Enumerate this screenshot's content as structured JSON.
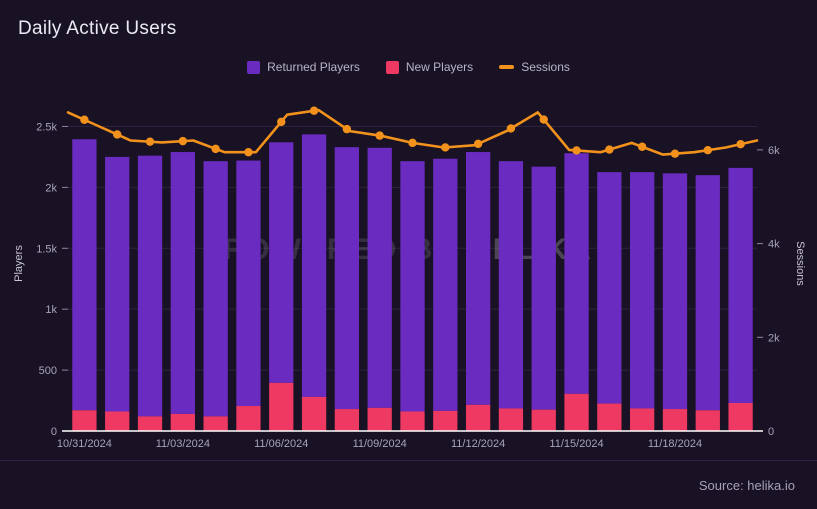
{
  "header": {
    "title": "Daily Active Users"
  },
  "legend": {
    "items": [
      {
        "label": "Returned Players",
        "color": "#6a2cc0",
        "marker": "square"
      },
      {
        "label": "New Players",
        "color": "#ee3a62",
        "marker": "square"
      },
      {
        "label": "Sessions",
        "color": "#f2921d",
        "marker": "line"
      }
    ]
  },
  "footer": {
    "source": "Source: helika.io"
  },
  "watermark": {
    "prefix": "POWERED BY ",
    "brand": "HELIKA"
  },
  "chart_data": {
    "type": "bar",
    "title": "Daily Active Users",
    "xlabel": "",
    "ylabel": "Players",
    "y2label": "Sessions",
    "ylim": [
      0,
      2750
    ],
    "y2lim": [
      0,
      7150
    ],
    "yticks": [
      0,
      500,
      1000,
      1500,
      2000,
      2500
    ],
    "ytick_labels": [
      "0",
      "500",
      "1k",
      "1.5k",
      "2k",
      "2.5k"
    ],
    "y2ticks": [
      0,
      2000,
      4000,
      6000
    ],
    "y2tick_labels": [
      "0",
      "2k",
      "4k",
      "6k"
    ],
    "grid": true,
    "legend_position": "top-center",
    "stacked": true,
    "categories": [
      "10/31/2024",
      "11/01/2024",
      "11/02/2024",
      "11/03/2024",
      "11/04/2024",
      "11/05/2024",
      "11/06/2024",
      "11/07/2024",
      "11/08/2024",
      "11/09/2024",
      "11/10/2024",
      "11/11/2024",
      "11/12/2024",
      "11/13/2024",
      "11/14/2024",
      "11/15/2024",
      "11/16/2024",
      "11/17/2024",
      "11/18/2024",
      "11/19/2024",
      "11/20/2024"
    ],
    "xtick_labels": [
      "10/31/2024",
      "11/03/2024",
      "11/06/2024",
      "11/09/2024",
      "11/12/2024",
      "11/15/2024",
      "11/18/2024"
    ],
    "xtick_indices": [
      0,
      3,
      6,
      9,
      12,
      15,
      18
    ],
    "series": [
      {
        "name": "New Players",
        "color": "#ee3a62",
        "type": "bar",
        "axis": "left",
        "values": [
          170,
          160,
          120,
          140,
          120,
          205,
          395,
          280,
          180,
          190,
          160,
          165,
          215,
          185,
          175,
          305,
          225,
          185,
          180,
          170,
          230
        ]
      },
      {
        "name": "Returned Players",
        "color": "#6a2cc0",
        "type": "bar",
        "axis": "left",
        "values": [
          2225,
          2090,
          2140,
          2150,
          2095,
          2015,
          1975,
          2155,
          2150,
          2135,
          2055,
          2070,
          2075,
          2030,
          1995,
          1975,
          1900,
          1940,
          1935,
          1930,
          1930
        ]
      },
      {
        "name": "Sessions",
        "color": "#f2921d",
        "type": "line",
        "axis": "right",
        "values": [
          6800,
          6500,
          6200,
          6160,
          6200,
          5950,
          5950,
          6750,
          6850,
          6400,
          6300,
          6150,
          6050,
          6100,
          6400,
          6800,
          6000,
          5950,
          6150,
          5900,
          5950,
          6050,
          6200
        ]
      }
    ]
  }
}
